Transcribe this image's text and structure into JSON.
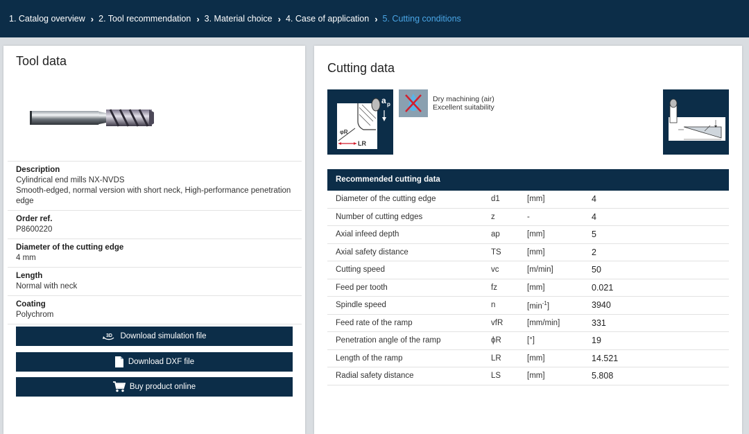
{
  "breadcrumb": [
    {
      "label": "1. Catalog overview",
      "active": false
    },
    {
      "label": "2. Tool recommendation",
      "active": false
    },
    {
      "label": "3. Material choice",
      "active": false
    },
    {
      "label": "4. Case of application",
      "active": false
    },
    {
      "label": "5. Cutting conditions",
      "active": true
    }
  ],
  "tool_data": {
    "title": "Tool data",
    "description_label": "Description",
    "description_line1": "Cylindrical end mills   NX-NVDS",
    "description_line2": "Smooth-edged, normal version with short neck, High-performance penetration edge",
    "order_label": "Order ref.",
    "order_value": "P8600220",
    "diameter_label": "Diameter of the cutting edge",
    "diameter_value": "4 mm",
    "length_label": "Length",
    "length_value": "Normal with neck",
    "coating_label": "Coating",
    "coating_value": "Polychrom"
  },
  "buttons": {
    "simulation": "Download simulation file",
    "simulation_icon_text": "3D",
    "dxf": "Download DXF file",
    "buy": "Buy product online"
  },
  "cutting_data": {
    "title": "Cutting data",
    "diagram_label_ap": "a",
    "diagram_label_ap_sub": "p",
    "diagram_label_phiR": "φR",
    "diagram_label_LR": "LR",
    "dry_line1": "Dry machining (air)",
    "dry_line2": "Excellent suitability",
    "table_title": "Recommended cutting data",
    "rows": [
      {
        "name": "Diameter of the cutting edge",
        "symbol": "d1",
        "unit": "[mm]",
        "value": "4"
      },
      {
        "name": "Number of cutting edges",
        "symbol": "z",
        "unit": "-",
        "value": "4"
      },
      {
        "name": "Axial infeed depth",
        "symbol": "ap",
        "unit": "[mm]",
        "value": "5"
      },
      {
        "name": "Axial safety distance",
        "symbol": "TS",
        "unit": "[mm]",
        "value": "2"
      },
      {
        "name": "Cutting speed",
        "symbol": "vc",
        "unit": "[m/min]",
        "value": "50"
      },
      {
        "name": "Feed per tooth",
        "symbol": "fz",
        "unit": "[mm]",
        "value": "0.021"
      },
      {
        "name": "Spindle speed",
        "symbol": "n",
        "unit": "[min-1]",
        "value": "3940"
      },
      {
        "name": "Feed rate of the ramp",
        "symbol": "vfR",
        "unit": "[mm/min]",
        "value": "331"
      },
      {
        "name": "Penetration angle of the ramp",
        "symbol": "ϕR",
        "unit": "[°]",
        "value": "19"
      },
      {
        "name": "Length of the ramp",
        "symbol": "LR",
        "unit": "[mm]",
        "value": "14.521"
      },
      {
        "name": "Radial safety distance",
        "symbol": "LS",
        "unit": "[mm]",
        "value": "5.808"
      }
    ]
  },
  "colors": {
    "navy": "#0c2d48",
    "active_crumb": "#4aa6e6",
    "background": "#d9dde1"
  }
}
